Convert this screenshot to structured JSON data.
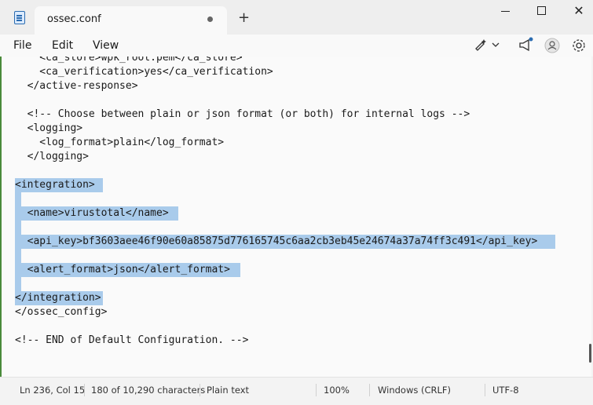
{
  "tab": {
    "title": "ossec.conf"
  },
  "menu": {
    "file": "File",
    "edit": "Edit",
    "view": "View"
  },
  "window_controls": {
    "close": "✕"
  },
  "new_tab_label": "+",
  "editor": {
    "lines": [
      "    <ca_store>wpk_root.pem</ca_store>",
      "    <ca_verification>yes</ca_verification>",
      "  </active-response>",
      "",
      "  <!-- Choose between plain or json format (or both) for internal logs -->",
      "  <logging>",
      "    <log_format>plain</log_format>",
      "  </logging>",
      "",
      "<integration>",
      "",
      "  <name>virustotal</name>",
      "",
      "  <api_key>bf3603aee46f90e60a85875d776165745c6aa2cb3eb45e24674a37a74ff3c491</api_key>",
      "",
      "  <alert_format>json</alert_format>",
      "",
      "</integration>",
      "</ossec_config>",
      "",
      "<!-- END of Default Configuration. -->"
    ]
  },
  "status": {
    "position": "Ln 236, Col 15",
    "selection": "180 of 10,290 characters",
    "format": "Plain text",
    "zoom": "100%",
    "line_ending": "Windows (CRLF)",
    "encoding": "UTF-8"
  },
  "accent": "#a9cbeb"
}
